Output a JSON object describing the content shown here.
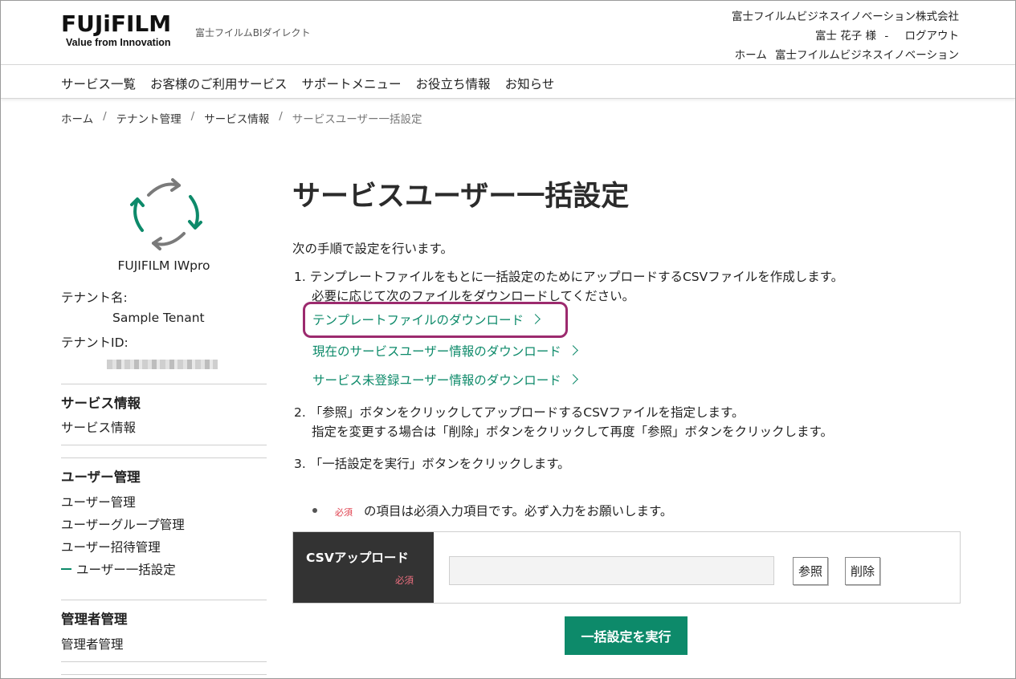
{
  "header": {
    "logo_text": "FUJiFILM",
    "logo_tagline": "Value from Innovation",
    "site_name": "富士フイルムBIダイレクト",
    "company": "富士フイルムビジネスイノベーション株式会社",
    "user_name": "富士 花子 様",
    "separator": "-",
    "logout": "ログアウト",
    "home_link": "ホーム",
    "company_link": "富士フイルムビジネスイノベーション"
  },
  "nav": {
    "items": [
      "サービス一覧",
      "お客様のご利用サービス",
      "サポートメニュー",
      "お役立ち情報",
      "お知らせ"
    ]
  },
  "breadcrumb": {
    "items": [
      "ホーム",
      "テナント管理",
      "サービス情報"
    ],
    "current": "サービスユーザー一括設定",
    "sep": "/"
  },
  "sidebar": {
    "app_name": "FUJIFILM IWpro",
    "tenant_name_label": "テナント名:",
    "tenant_name": "Sample Tenant",
    "tenant_id_label": "テナントID:",
    "sections": [
      {
        "heading": "サービス情報",
        "items": [
          "サービス情報"
        ]
      },
      {
        "heading": "ユーザー管理",
        "items": [
          "ユーザー管理",
          "ユーザーグループ管理",
          "ユーザー招待管理",
          "ユーザー一括設定"
        ]
      },
      {
        "heading": "管理者管理",
        "items": [
          "管理者管理"
        ]
      }
    ],
    "colors": {
      "accent": "#0d8a6a",
      "icon_gray": "#7a7a7a"
    }
  },
  "main": {
    "title": "サービスユーザー一括設定",
    "intro": "次の手順で設定を行います。",
    "step1_line1": "1. テンプレートファイルをもとに一括設定のためにアップロードするCSVファイルを作成します。",
    "step1_line2": "必要に応じて次のファイルをダウンロードしてください。",
    "download_links": [
      "テンプレートファイルのダウンロード",
      "現在のサービスユーザー情報のダウンロード",
      "サービス未登録ユーザー情報のダウンロード"
    ],
    "step2_line1": "2. 「参照」ボタンをクリックしてアップロードするCSVファイルを指定します。",
    "step2_line2": "指定を変更する場合は「削除」ボタンをクリックして再度「参照」ボタンをクリックします。",
    "step3": "3. 「一括設定を実行」ボタンをクリックします。",
    "required_badge": "必須",
    "required_note": "の項目は必須入力項目です。必ず入力をお願いします。",
    "form_label": "CSVアップロード",
    "file_value": "",
    "browse_button": "参照",
    "delete_button": "削除",
    "execute_button": "一括設定を実行",
    "colors": {
      "accent": "#0d8a6a",
      "highlight": "#9c2a6e",
      "required": "#e0404e"
    }
  }
}
